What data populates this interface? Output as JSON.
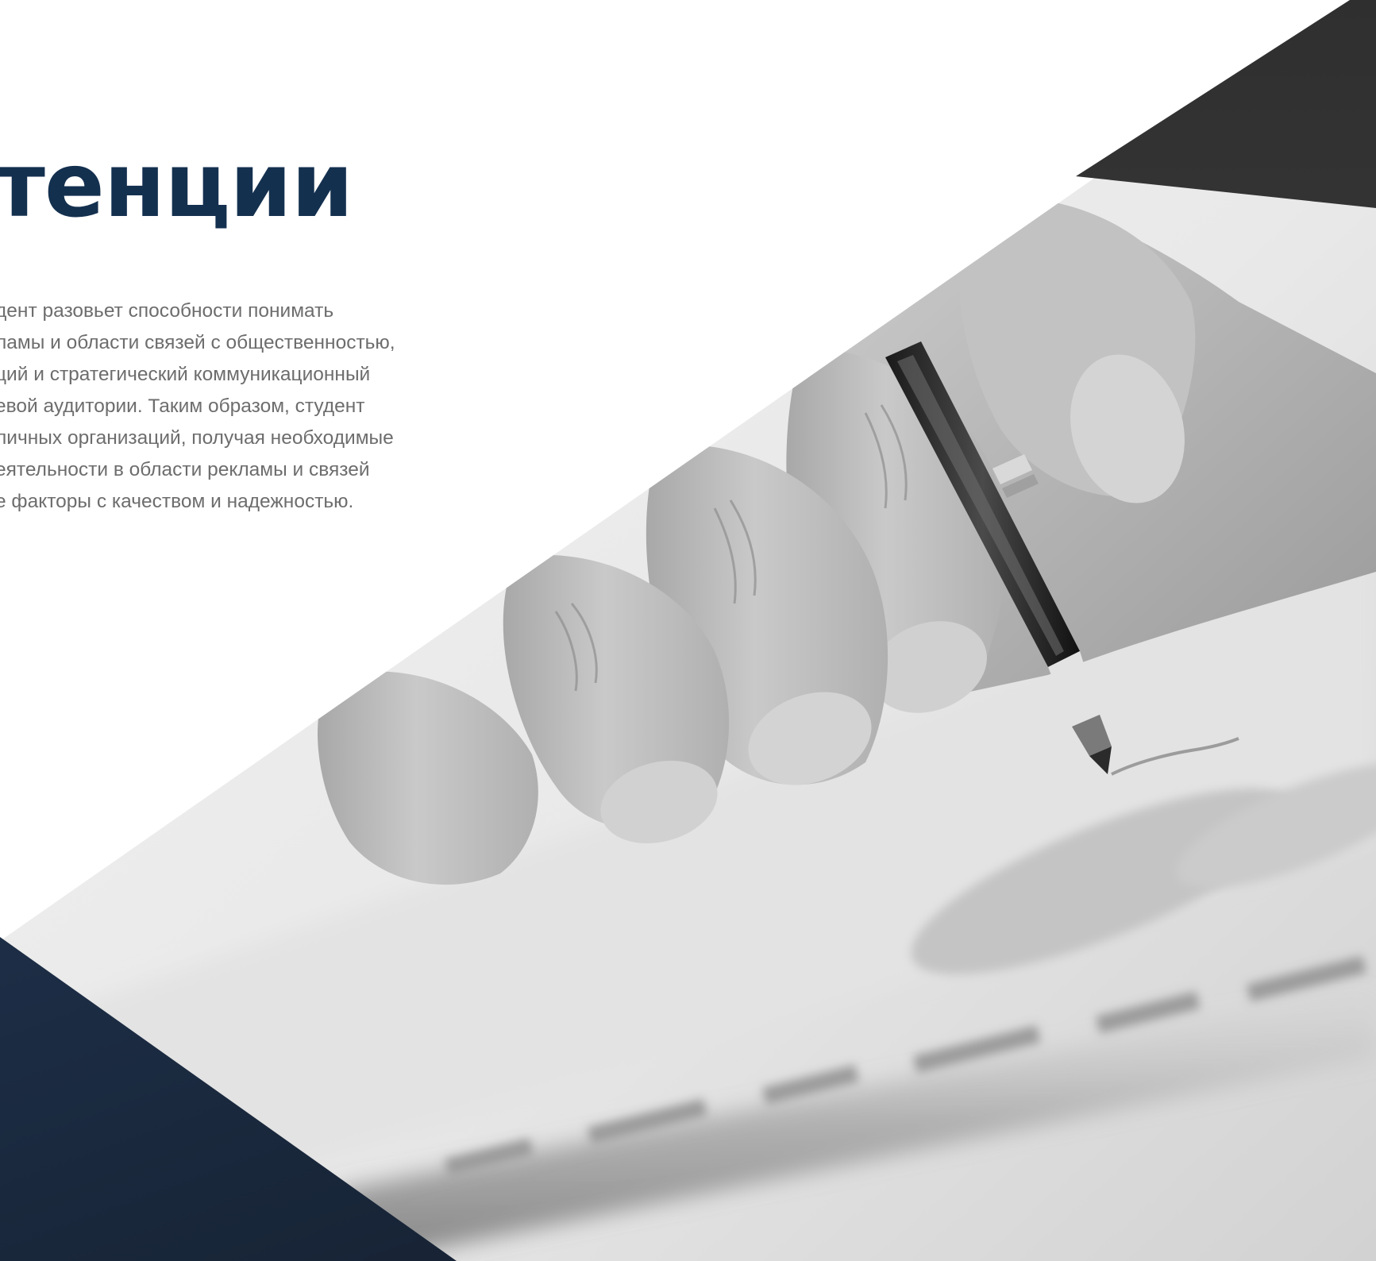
{
  "section": {
    "heading": "тенции",
    "body_lines": [
      "дент разовьет способности понимать",
      "ламы и области связей с общественностью,",
      "ций и стратегический коммуникационный",
      "евой аудитории. Таким образом, студент",
      "личных организаций, получая необходимые",
      "еятельности в области рекламы и связей",
      "е факторы с качеством и надежностью."
    ]
  },
  "image": {
    "subject": "hand-writing-with-pen",
    "style": "grayscale"
  },
  "colors": {
    "heading": "#14304f",
    "body_text": "#6d6d6d",
    "background": "#ffffff",
    "navy_accent": "#1f3553",
    "dark_accent": "#3c3c3c"
  }
}
